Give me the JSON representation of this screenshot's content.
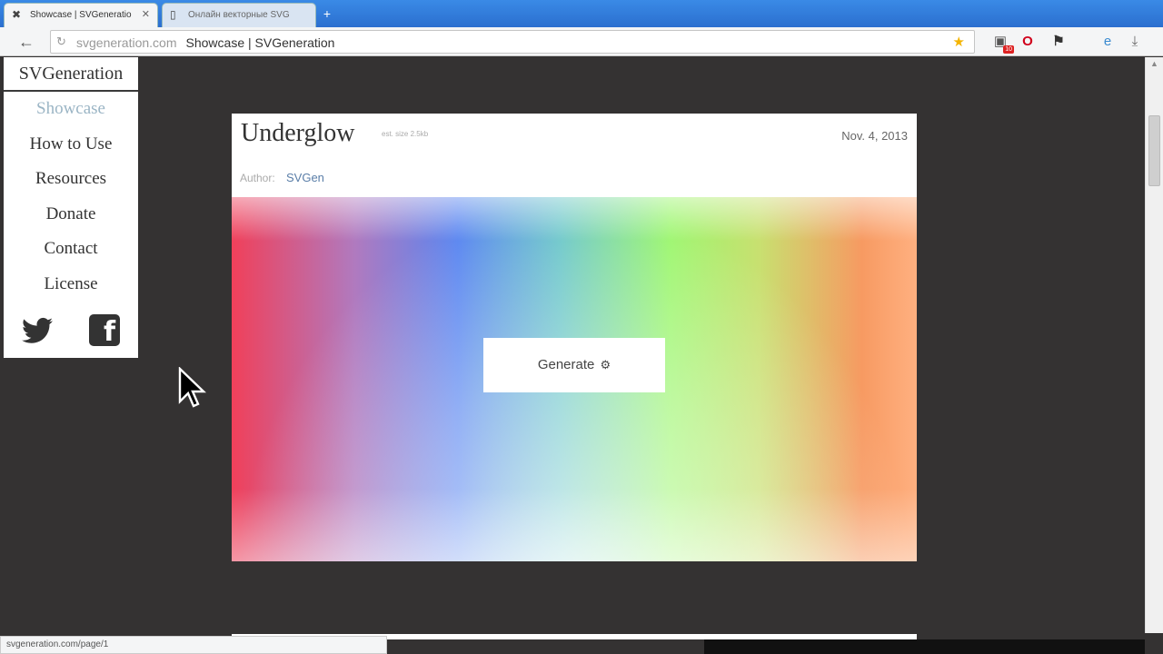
{
  "browser": {
    "tabs": [
      {
        "title": "Showcase | SVGeneratio",
        "active": true
      },
      {
        "title": "Онлайн векторные SVG",
        "active": false
      }
    ],
    "address": {
      "domain": "svgeneration.com",
      "page_title": "Showcase | SVGeneration"
    },
    "extensions": [
      "svg-extension-icon",
      "opera-icon",
      "pin-icon",
      "ie-icon",
      "download-icon"
    ],
    "extension_badge": "10",
    "status_text": "svgeneration.com/page/1"
  },
  "site": {
    "title": "SVGeneration",
    "nav": [
      {
        "label": "Showcase",
        "current": true
      },
      {
        "label": "How to Use",
        "current": false
      },
      {
        "label": "Resources",
        "current": false
      },
      {
        "label": "Donate",
        "current": false
      },
      {
        "label": "Contact",
        "current": false
      },
      {
        "label": "License",
        "current": false
      }
    ]
  },
  "card": {
    "title": "Underglow",
    "size": "est. size 2.5kb",
    "date": "Nov. 4, 2013",
    "author_label": "Author:",
    "author": "SVGen",
    "generate_label": "Generate"
  },
  "colors": {
    "background": "#343232",
    "nav_current": "#9bb5c5",
    "author_link": "#5a7ea8",
    "chrome_blue": "#2b6fcf"
  }
}
